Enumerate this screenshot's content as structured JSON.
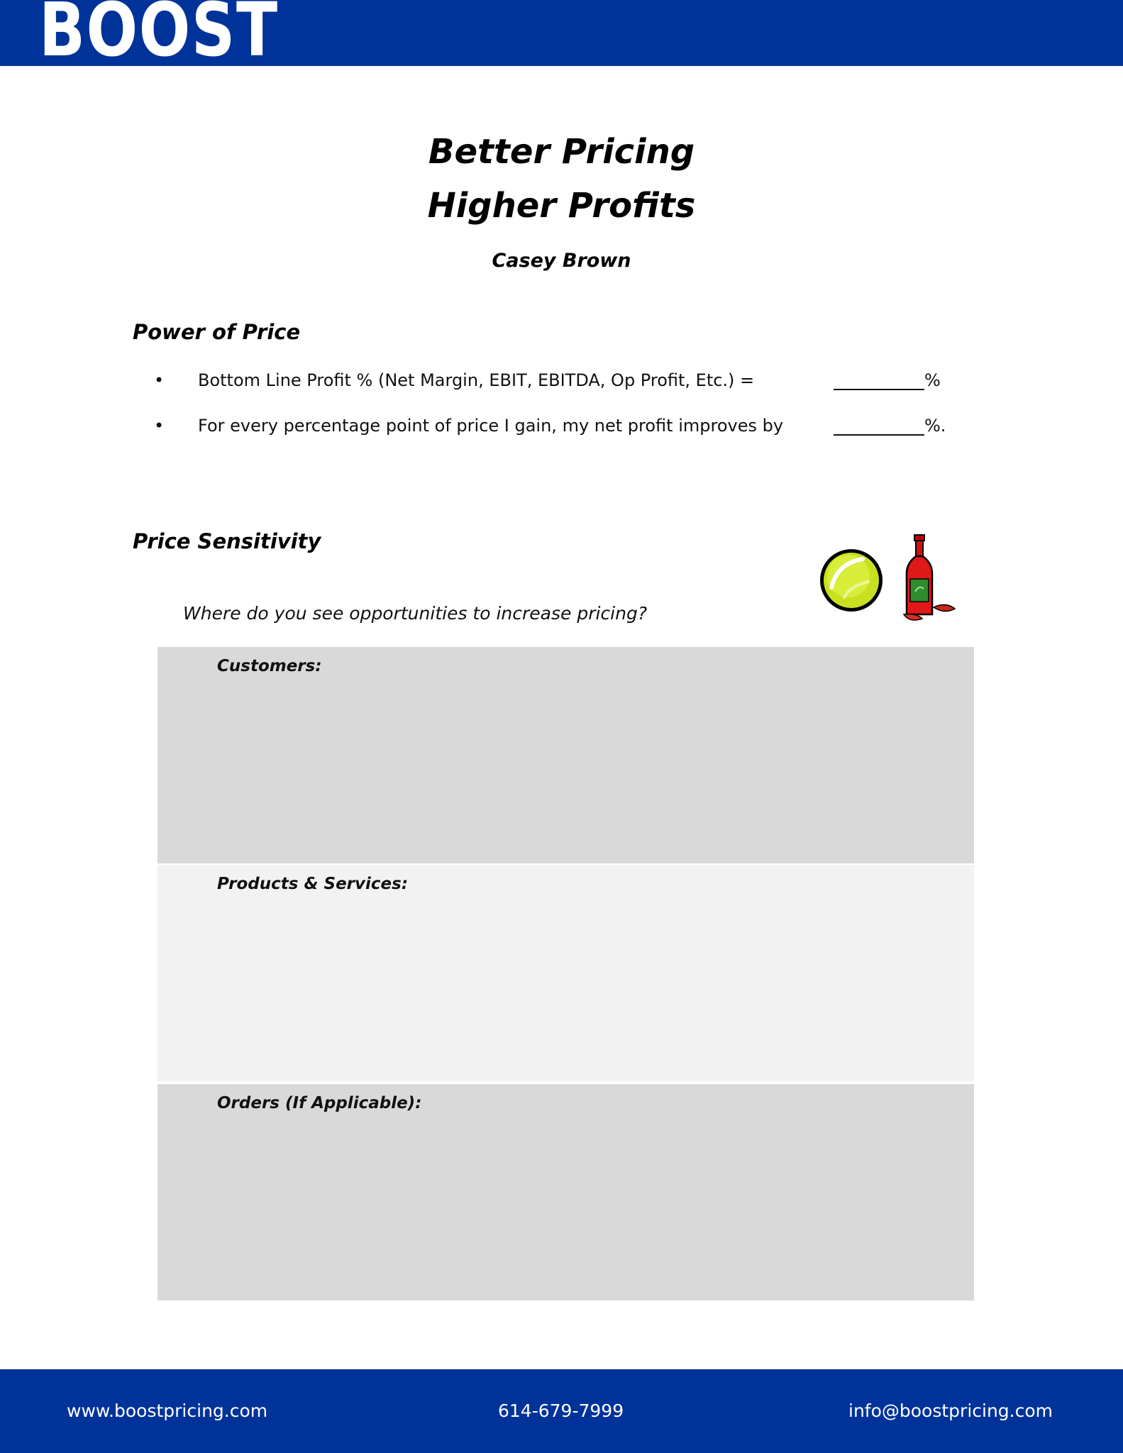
{
  "header": {
    "logo_text": "BOOST",
    "colors": {
      "brand_blue": "#003399",
      "shade_dark": "#d9d9d9",
      "shade_light": "#f2f2f2"
    }
  },
  "document": {
    "title_line1": "Better Pricing",
    "title_line2": "Higher Profits",
    "author": "Casey Brown"
  },
  "power_of_price": {
    "heading": "Power of Price",
    "bullets": [
      {
        "text": "Bottom Line Profit % (Net Margin, EBIT, EBITDA, Op Profit, Etc.) =",
        "suffix": "%"
      },
      {
        "text": "For every percentage point of price I gain, my net profit improves by",
        "suffix": "%."
      }
    ]
  },
  "price_sensitivity": {
    "heading": "Price Sensitivity",
    "question": "Where do you see opportunities to increase pricing?",
    "icons": [
      "tennis-ball-icon",
      "hot-sauce-bottle-icon"
    ],
    "boxes": [
      {
        "label": "Customers:"
      },
      {
        "label": "Products & Services:"
      },
      {
        "label": "Orders (If Applicable):"
      }
    ]
  },
  "footer": {
    "website": "www.boostpricing.com",
    "phone": "614-679-7999",
    "email": "info@boostpricing.com"
  }
}
